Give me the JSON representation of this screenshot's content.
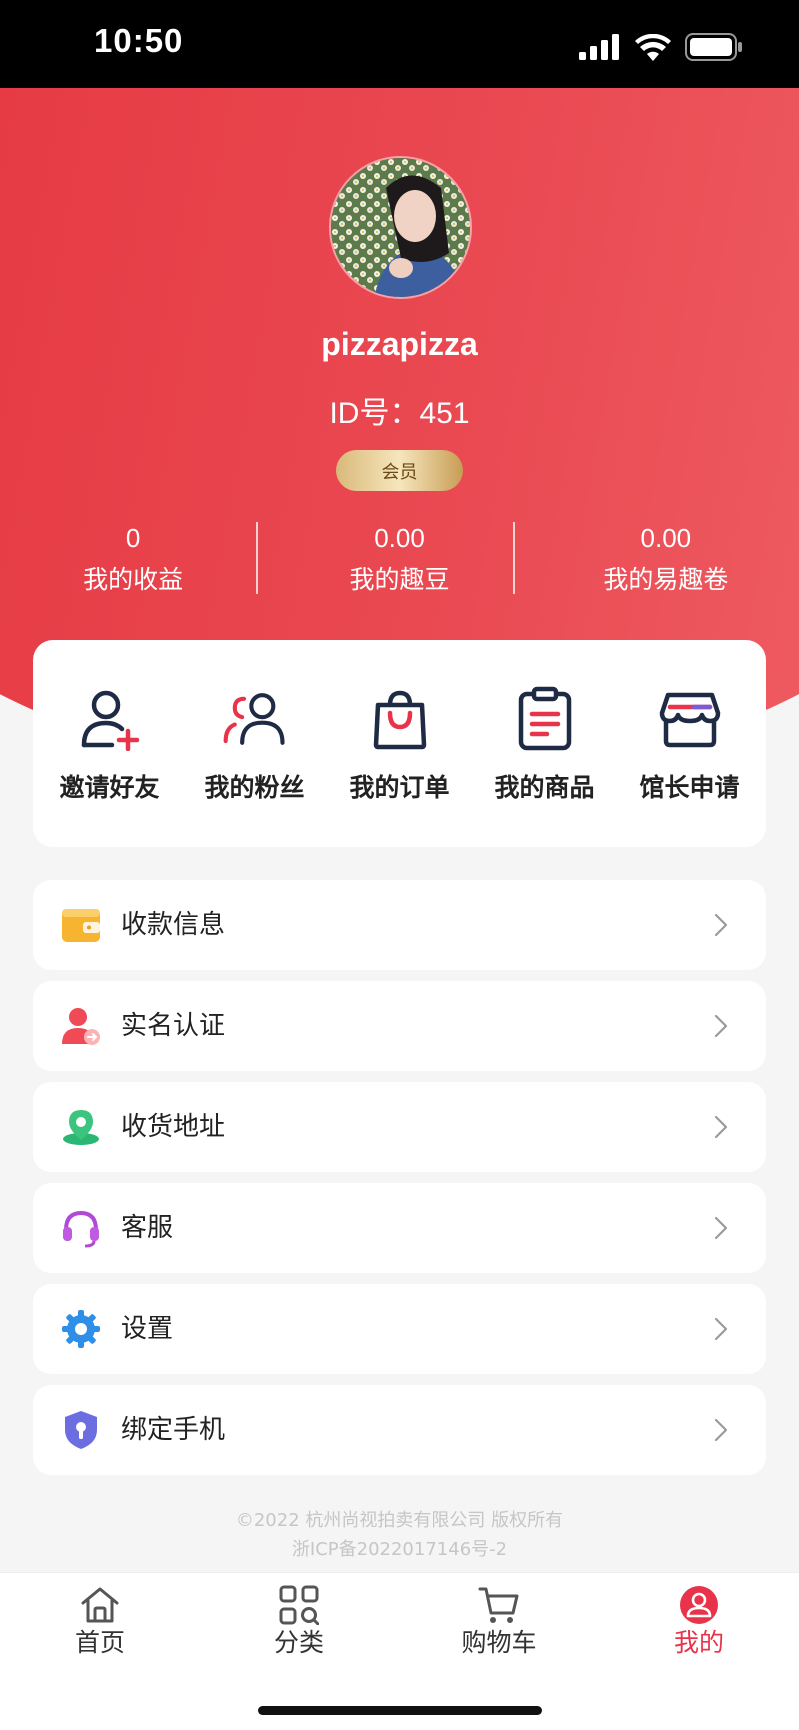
{
  "status_bar": {
    "time": "10:50"
  },
  "profile": {
    "username": "pizzapizza",
    "id_text": "ID号：451",
    "badge": "会员"
  },
  "stats": [
    {
      "value": "0",
      "label": "我的收益"
    },
    {
      "value": "0.00",
      "label": "我的趣豆"
    },
    {
      "value": "0.00",
      "label": "我的易趣卷"
    }
  ],
  "quick_actions": [
    {
      "label": "邀请好友",
      "icon": "invite-user-icon"
    },
    {
      "label": "我的粉丝",
      "icon": "fans-icon"
    },
    {
      "label": "我的订单",
      "icon": "shopping-bag-icon"
    },
    {
      "label": "我的商品",
      "icon": "clipboard-list-icon"
    },
    {
      "label": "馆长申请",
      "icon": "store-icon"
    }
  ],
  "menu": [
    {
      "label": "收款信息",
      "icon": "wallet-icon"
    },
    {
      "label": "实名认证",
      "icon": "user-verify-icon"
    },
    {
      "label": "收货地址",
      "icon": "location-icon"
    },
    {
      "label": "客服",
      "icon": "headset-icon"
    },
    {
      "label": "设置",
      "icon": "settings-gear-icon"
    },
    {
      "label": "绑定手机",
      "icon": "shield-lock-icon"
    }
  ],
  "footer": {
    "copyright": "©2022 杭州尚视拍卖有限公司 版权所有",
    "icp": "浙ICP备2022017146号-2"
  },
  "tabbar": [
    {
      "label": "首页",
      "icon": "home-icon"
    },
    {
      "label": "分类",
      "icon": "category-icon"
    },
    {
      "label": "购物车",
      "icon": "cart-icon"
    },
    {
      "label": "我的",
      "icon": "profile-icon",
      "active": true
    }
  ],
  "colors": {
    "brand_red": "#e63b45",
    "active_tab": "#e8334a",
    "badge_gold": "#d9b97a"
  }
}
